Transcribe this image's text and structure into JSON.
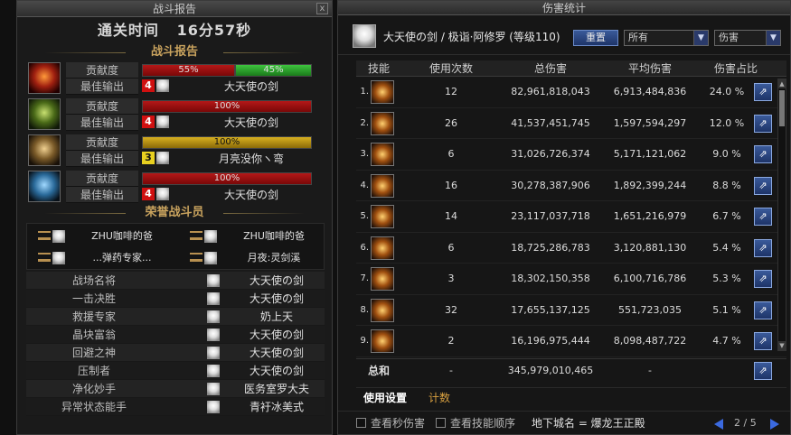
{
  "left": {
    "window_title": "战斗报告",
    "close_glyph": "x",
    "clear_time_label": "通关时间",
    "clear_time_value": "16分57秒",
    "report_header": "战斗报告",
    "contribution_label": "贡献度",
    "best_output_label": "最佳输出",
    "contributions": [
      {
        "icon": "flame-emblem-icon",
        "icon_color": "red",
        "segments": [
          {
            "pct": 55,
            "label": "55%",
            "color": "red"
          },
          {
            "pct": 45,
            "label": "45%",
            "color": "green"
          }
        ],
        "rank_badge": "4",
        "badge_color": "red",
        "best": "大天使の剑"
      },
      {
        "icon": "nature-emblem-icon",
        "icon_color": "green",
        "segments": [
          {
            "pct": 100,
            "label": "100%",
            "color": "red"
          }
        ],
        "rank_badge": "4",
        "badge_color": "red",
        "best": "大天使の剑"
      },
      {
        "icon": "gold-emblem-icon",
        "icon_color": "gold",
        "segments": [
          {
            "pct": 100,
            "label": "100%",
            "color": "gold"
          }
        ],
        "rank_badge": "3",
        "badge_color": "yellow",
        "best": "月亮没你ヽ弯"
      },
      {
        "icon": "ice-emblem-icon",
        "icon_color": "blue",
        "segments": [
          {
            "pct": 100,
            "label": "100%",
            "color": "red"
          }
        ],
        "rank_badge": "4",
        "badge_color": "red",
        "best": "大天使の剑"
      }
    ],
    "honor_header": "荣誉战斗员",
    "honor": [
      "ZHU咖啡的爸",
      "ZHU咖啡的爸",
      "...弹药专家...",
      "月夜:灵剑溪"
    ],
    "awards": [
      {
        "title": "战场名将",
        "name": "大天使の剑"
      },
      {
        "title": "一击决胜",
        "name": "大天使の剑"
      },
      {
        "title": "救援专家",
        "name": "奶上天"
      },
      {
        "title": "晶块富翁",
        "name": "大天使の剑"
      },
      {
        "title": "回避之神",
        "name": "大天使の剑"
      },
      {
        "title": "压制者",
        "name": "大天使の剑"
      },
      {
        "title": "净化妙手",
        "name": "医务室罗大夫"
      },
      {
        "title": "异常状态能手",
        "name": "青衧冰美式"
      }
    ]
  },
  "right": {
    "window_title": "伤害统计",
    "player": "大天使の剑 / 极诣·阿修罗 (等级110)",
    "reset_label": "重置",
    "select1": "所有",
    "select2": "伤害",
    "dropdown_glyph": "▼",
    "columns": [
      "技能",
      "使用次数",
      "总伤害",
      "平均伤害",
      "伤害占比"
    ],
    "rows": [
      {
        "idx": "1.",
        "count": "12",
        "total": "82,961,818,043",
        "avg": "6,913,484,836",
        "pct": "24.0 %"
      },
      {
        "idx": "2.",
        "count": "26",
        "total": "41,537,451,745",
        "avg": "1,597,594,297",
        "pct": "12.0 %"
      },
      {
        "idx": "3.",
        "count": "6",
        "total": "31,026,726,374",
        "avg": "5,171,121,062",
        "pct": "9.0 %"
      },
      {
        "idx": "4.",
        "count": "16",
        "total": "30,278,387,906",
        "avg": "1,892,399,244",
        "pct": "8.8 %"
      },
      {
        "idx": "5.",
        "count": "14",
        "total": "23,117,037,718",
        "avg": "1,651,216,979",
        "pct": "6.7 %"
      },
      {
        "idx": "6.",
        "count": "6",
        "total": "18,725,286,783",
        "avg": "3,120,881,130",
        "pct": "5.4 %"
      },
      {
        "idx": "7.",
        "count": "3",
        "total": "18,302,150,358",
        "avg": "6,100,716,786",
        "pct": "5.3 %"
      },
      {
        "idx": "8.",
        "count": "32",
        "total": "17,655,137,125",
        "avg": "551,723,035",
        "pct": "5.1 %"
      },
      {
        "idx": "9.",
        "count": "2",
        "total": "16,196,975,444",
        "avg": "8,098,487,722",
        "pct": "4.7 %"
      }
    ],
    "total_label": "总和",
    "total_count": "-",
    "total_damage": "345,979,010,465",
    "total_avg": "-",
    "tab_usage": "使用设置",
    "tab_count": "计数",
    "chk_per_second": "查看秒伤害",
    "chk_skill_order": "查看技能顺序",
    "dungeon": "地下城名 = 爆龙王正殿",
    "page": "2 / 5",
    "share_glyph": "⇗",
    "scroll_up_glyph": "▲",
    "scroll_down_glyph": "▼"
  }
}
